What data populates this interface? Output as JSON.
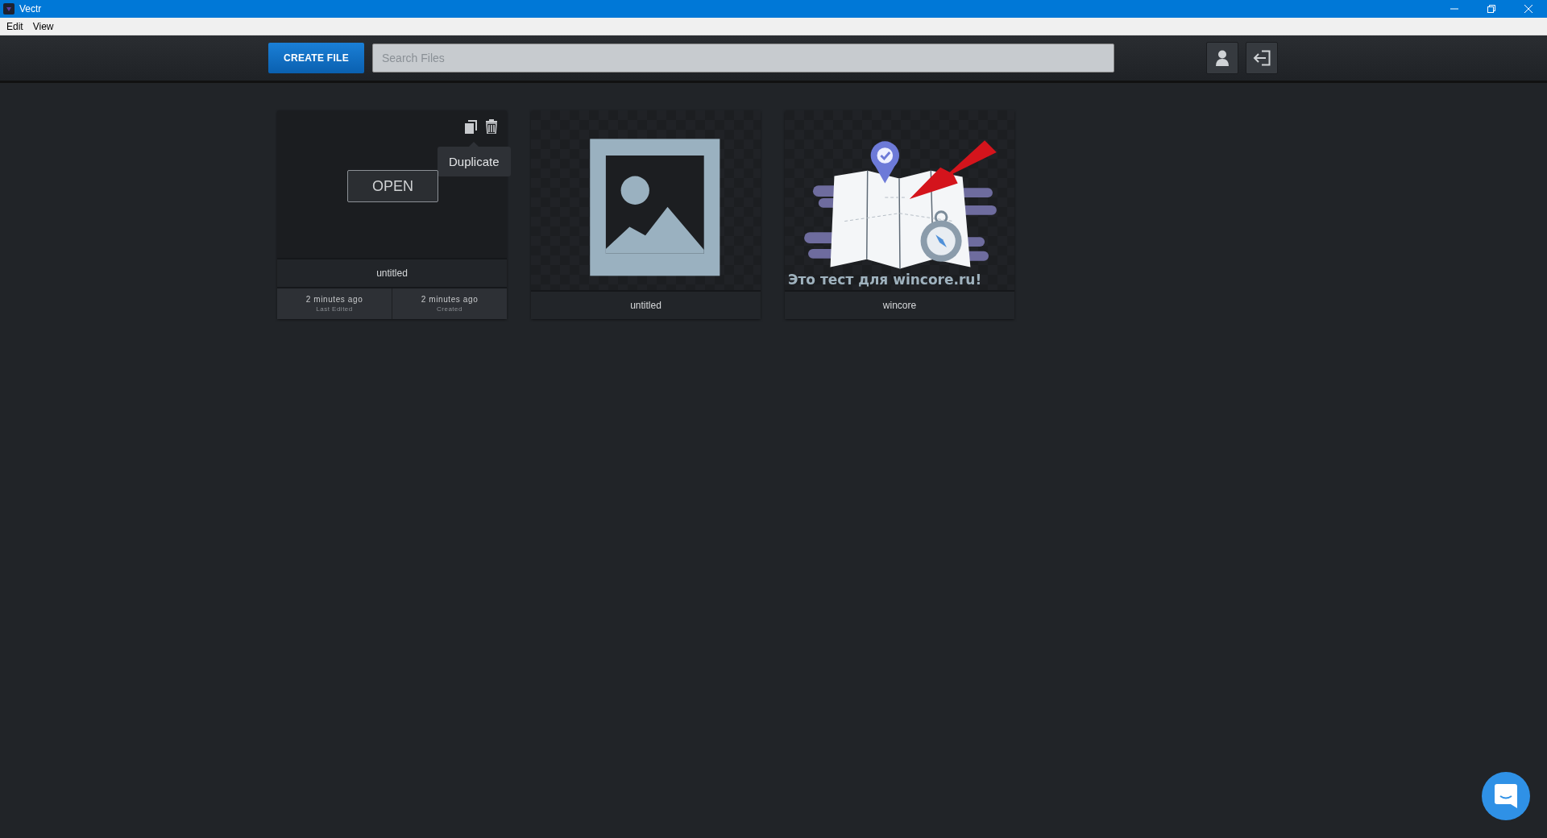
{
  "window": {
    "title": "Vectr"
  },
  "menu": [
    "Edit",
    "View"
  ],
  "toolbar": {
    "create_button": "CREATE FILE",
    "search": {
      "placeholder": "Search Files"
    }
  },
  "files": [
    {
      "name": "untitled",
      "hovered": true,
      "thumbnail": {
        "kind": "blank"
      },
      "open_button": "OPEN",
      "tooltip": "Duplicate",
      "dates": [
        {
          "value": "2 minutes ago",
          "label": "Last Edited"
        },
        {
          "value": "2 minutes ago",
          "label": "Created"
        }
      ]
    },
    {
      "name": "untitled",
      "hovered": false,
      "thumbnail": {
        "kind": "placeholder"
      }
    },
    {
      "name": "wincore",
      "hovered": false,
      "thumbnail": {
        "kind": "map",
        "caption": "Это тест для wincore.ru!"
      }
    }
  ]
}
